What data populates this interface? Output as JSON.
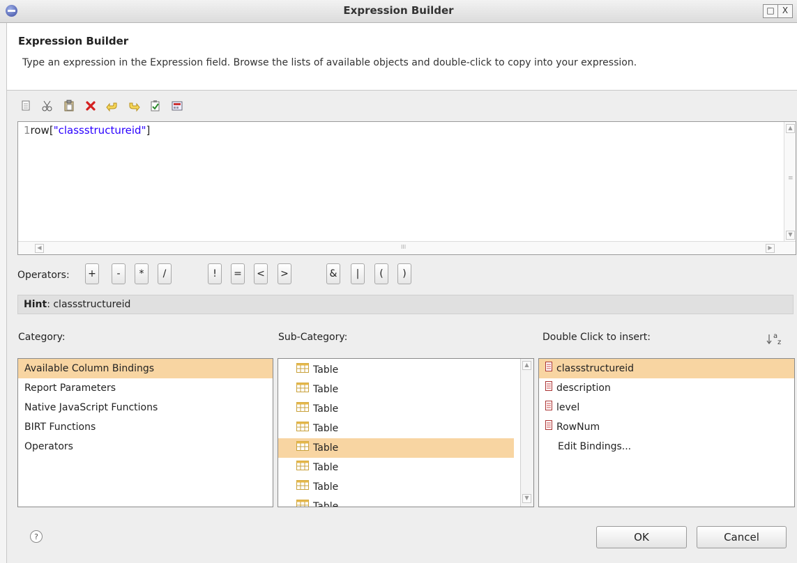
{
  "window": {
    "title": "Expression Builder",
    "buttons": [
      "□",
      "X"
    ]
  },
  "header": {
    "title": "Expression Builder",
    "description": "Type an expression in the Expression field. Browse the lists of available objects and double-click to copy into your expression."
  },
  "toolbar": {
    "icons": [
      "copy-icon",
      "cut-icon",
      "paste-icon",
      "delete-icon",
      "undo-icon",
      "redo-icon",
      "validate-icon",
      "calculator-icon"
    ]
  },
  "editor": {
    "line_number": "1",
    "code_prefix": "row[",
    "code_string": "\"classstructureid\"",
    "code_suffix": "]",
    "hscroll_grip": "III",
    "vscroll_grip": "≡"
  },
  "operators": {
    "label": "Operators:",
    "buttons": [
      "+",
      "-",
      "*",
      "/",
      "!",
      "=",
      "<",
      ">",
      "&",
      "|",
      "(",
      ")"
    ]
  },
  "hint": {
    "label": "Hint",
    "text": ": classstructureid"
  },
  "category": {
    "label": "Category:",
    "items": [
      "Available Column Bindings",
      "Report Parameters",
      "Native JavaScript Functions",
      "BIRT Functions",
      "Operators"
    ],
    "selected_index": 0
  },
  "subcategory": {
    "label": "Sub-Category:",
    "items": [
      "Table",
      "Table",
      "Table",
      "Table",
      "Table",
      "Table",
      "Table",
      "Table"
    ],
    "selected_index": 4
  },
  "insert": {
    "label": "Double Click to insert:",
    "items": [
      "classstructureid",
      "description",
      "level",
      "RowNum"
    ],
    "edit_bindings": "Edit Bindings...",
    "selected_index": 0
  },
  "buttons": {
    "ok": "OK",
    "cancel": "Cancel",
    "help": "?"
  },
  "colors": {
    "selection": "#f8d5a2",
    "string_literal": "#2a00ff",
    "hint_bar": "#e0e0e0"
  }
}
